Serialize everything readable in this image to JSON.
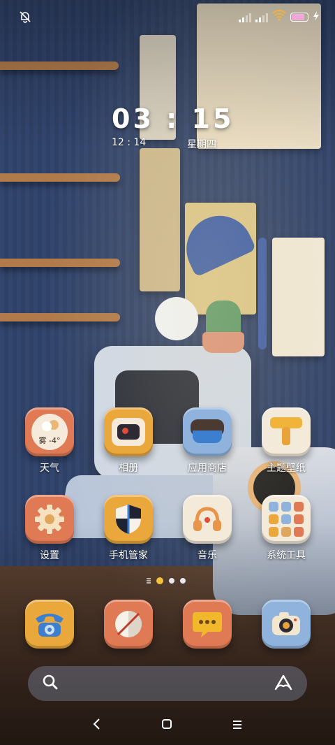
{
  "status_bar": {
    "left_icon": "bell-muted-icon",
    "signal_icon": "cellular-signal-icon",
    "wifi_icon": "wifi-icon",
    "battery_icon": "battery-icon",
    "battery_color": "#f0a8d8",
    "charging_icon": "charging-bolt-icon"
  },
  "clock_widget": {
    "time": "03 : 15",
    "sub_time": "12 : 14",
    "weekday": "星期四"
  },
  "apps": [
    {
      "label": "天气",
      "icon": "weather-icon",
      "badge": "雾 -4°",
      "bg": "#e07a55"
    },
    {
      "label": "相册",
      "icon": "photo-album-icon",
      "bg": "#eaa83c"
    },
    {
      "label": "应用商店",
      "icon": "app-store-icon",
      "bg": "#8fb3dc"
    },
    {
      "label": "主题壁纸",
      "icon": "theme-wallpaper-icon",
      "bg": "#f3ead9"
    },
    {
      "label": "设置",
      "icon": "settings-gear-icon",
      "bg": "#e07a55"
    },
    {
      "label": "手机管家",
      "icon": "security-shield-icon",
      "bg": "#eaa83c"
    },
    {
      "label": "音乐",
      "icon": "headphones-icon",
      "bg": "#f3ead9"
    },
    {
      "label": "系统工具",
      "icon": "system-tools-folder-icon",
      "bg": "#f3ead9"
    }
  ],
  "dock": [
    {
      "icon": "phone-icon",
      "bg": "#eaa83c"
    },
    {
      "icon": "browser-icon",
      "bg": "#e07a55"
    },
    {
      "icon": "messages-icon",
      "bg": "#e07a55"
    },
    {
      "icon": "camera-icon",
      "bg": "#8fb3dc"
    }
  ],
  "page_indicator": {
    "pages": 3,
    "active": 1
  },
  "search_bar": {
    "search_icon": "search-icon",
    "assistant_icon": "assistant-icon"
  },
  "nav_bar": {
    "back_icon": "back-icon",
    "home_icon": "home-icon",
    "recents_icon": "menu-icon"
  }
}
